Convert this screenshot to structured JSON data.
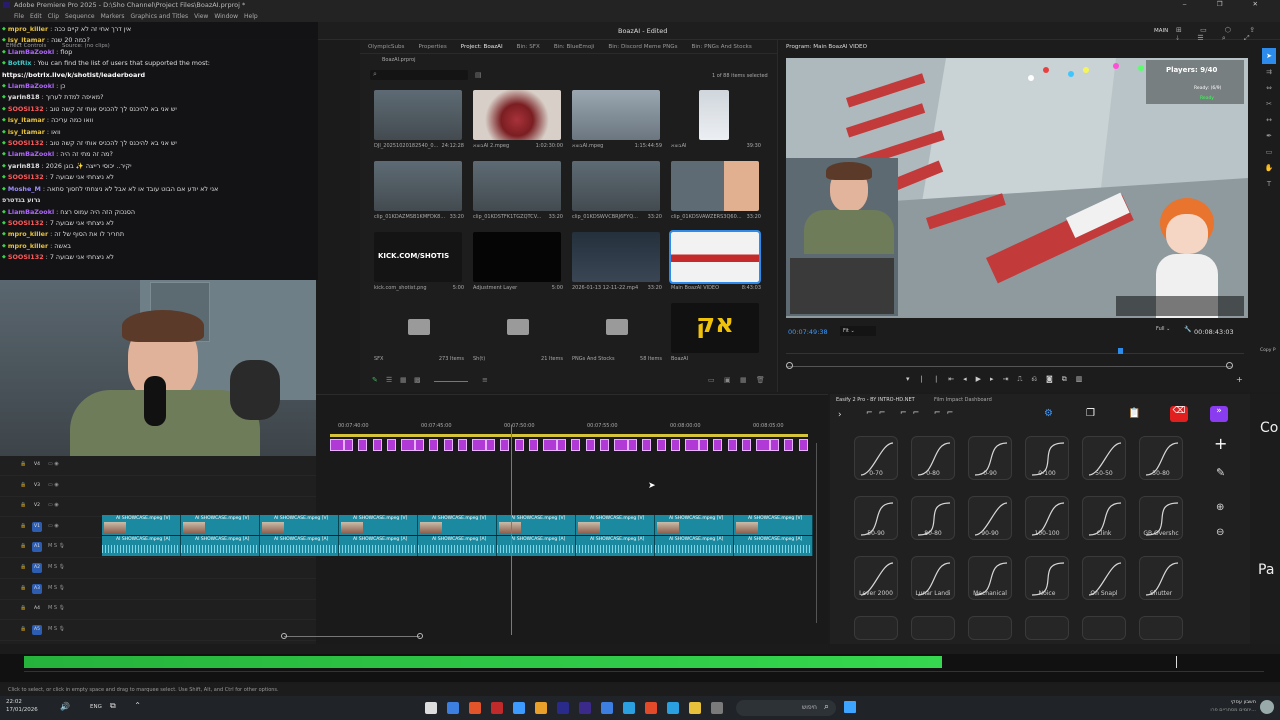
{
  "window": {
    "title": "Adobe Premiere Pro 2025 - D:\\Sho Channel\\Project Files\\BoazAI.prproj *",
    "center_title": "BoazAI - Edited",
    "workspace": "MAIN"
  },
  "menu": [
    "File",
    "Edit",
    "Clip",
    "Sequence",
    "Markers",
    "Graphics and Titles",
    "View",
    "Window",
    "Help"
  ],
  "chat": [
    {
      "user": "mpro_killer",
      "sep": ":",
      "msg": "אין דרך אחי זה לא קיים ככה",
      "color": "#e8c23a"
    },
    {
      "user": "isy_itamar",
      "sep": ":",
      "msg": "כמה 20 שנה?",
      "color": "#e8c23a"
    },
    {
      "user": "LiamBaZookl",
      "sep": ":",
      "msg": "flop",
      "color": "#b066ff"
    },
    {
      "user": "BotRix",
      "sep": ":",
      "msg": "You can find the list of users that supported the most:",
      "color": "#40c9c9"
    },
    {
      "user": "",
      "sep": "",
      "msg": "https://botrix.live/k/shotist/leaderboard",
      "color": "#ffffff"
    },
    {
      "user": "LiamBaZookl",
      "sep": ":",
      "msg": "כן",
      "color": "#b066ff"
    },
    {
      "user": "yarin818",
      "sep": ":",
      "msg": "מאיפה למדת לערוך?",
      "color": "#e0e0e0"
    },
    {
      "user": "SOOSI132",
      "sep": ":",
      "msg": "יש אני בא להיכנס לך להכניס אותי זה קשה טוב",
      "color": "#ff5a5a"
    },
    {
      "user": "isy_itamar",
      "sep": ":",
      "msg": "וואו כמה עריכה",
      "color": "#e8c23a"
    },
    {
      "user": "isy_itamar",
      "sep": ":",
      "msg": "וואו",
      "color": "#e8c23a"
    },
    {
      "user": "SOOSI132",
      "sep": ":",
      "msg": "יש אני בא להיכנס לך להכניס אותי זה קשה טוב",
      "color": "#ff5a5a"
    },
    {
      "user": "LiamBaZookl",
      "sep": ":",
      "msg": "מה זה מתי זה היה?",
      "color": "#b066ff"
    },
    {
      "user": "yarin818",
      "sep": ":",
      "msg": "יקיר.. יכוסי רייצה ✨ בוגן 2026",
      "color": "#e0e0e0"
    },
    {
      "user": "SOOSI132",
      "sep": ":",
      "msg": "לא ניצחתי אני שבועה 7",
      "color": "#ff5a5a"
    },
    {
      "user": "Moshe_M",
      "sep": ":",
      "msg": "אני לא יודע אם הבוט עובד או לא אבל לא ניצחתי לחסוך סתאה",
      "color": "#9b8cff"
    },
    {
      "user": "",
      "sep": "",
      "msg": "גרוע בגדטרפ",
      "color": "#dddddd"
    },
    {
      "user": "LiamBaZookl",
      "sep": ":",
      "msg": "הסנכוק הזה היה עמוס רצח",
      "color": "#b066ff"
    },
    {
      "user": "SOOSI132",
      "sep": ":",
      "msg": "לא ניצחתי אני שבועה 7",
      "color": "#ff5a5a"
    },
    {
      "user": "mpro_killer",
      "sep": ":",
      "msg": "תחריר לו את הסוף של זה",
      "color": "#e8c23a"
    },
    {
      "user": "mpro_killer",
      "sep": ":",
      "msg": "באשה",
      "color": "#e8c23a"
    },
    {
      "user": "SOOSI132",
      "sep": ":",
      "msg": "לא ניצחתי אני שבועה 7",
      "color": "#ff5a5a"
    }
  ],
  "left_panel_tabs": [
    "Effect Controls",
    "Source: (no clips)"
  ],
  "project": {
    "tabs": [
      "OlympicSubs",
      "Properties",
      "Project: BoazAI",
      "Bin: SFX",
      "Bin: BlueEmoji",
      "Bin: Discord Meme PNGs",
      "Bin: PNGs And Stocks"
    ],
    "active_tab": "Project: BoazAI",
    "file": "BoazAI.prproj",
    "count": "1 of 88 items selected",
    "items": [
      {
        "name": "DJI_20251020182540_0...",
        "dur": "24:12:28",
        "kind": "webcam"
      },
      {
        "name": "בוצאAI 2.mpeg",
        "dur": "1:02:30:00",
        "kind": "food"
      },
      {
        "name": "בוצאAI.mpeg",
        "dur": "1:15:44:59",
        "kind": "room"
      },
      {
        "name": "בוצאAI",
        "dur": "39:30",
        "kind": "avatar"
      },
      {
        "name": "clip_01KDAZMSB1KMFDK8...",
        "dur": "33:20",
        "kind": "webcam"
      },
      {
        "name": "clip_01KDSTFK1TGZQTCV...",
        "dur": "33:20",
        "kind": "webcam"
      },
      {
        "name": "clip_01KDSWVCBRJ6FYQ...",
        "dur": "33:20",
        "kind": "webcam"
      },
      {
        "name": "clip_01KDSVAWZERS3Q60...",
        "dur": "33:20",
        "kind": "avatarcam"
      },
      {
        "name": "kick.com_shotist.png",
        "dur": "5:00",
        "kind": "kick"
      },
      {
        "name": "Adjustment Layer",
        "dur": "5:00",
        "kind": "black"
      },
      {
        "name": "2026-01-13 12-11-22.mp4",
        "dur": "33:20",
        "kind": "screen"
      },
      {
        "name": "Main BoazAI VIDEO",
        "dur": "8:43:03",
        "kind": "sequence"
      },
      {
        "name": "SFX",
        "dur": "273 Items",
        "kind": "folder"
      },
      {
        "name": "Sh(t)",
        "dur": "",
        "kind": "folder"
      },
      {
        "name": "PNGs And Stocks",
        "dur": "58 Items",
        "kind": "folder"
      },
      {
        "name": "BoazAI",
        "dur": "",
        "kind": "logo"
      }
    ],
    "folder_mid_count": "21 Items",
    "kick_text": "KICK.COM/SHOTIS",
    "logo_text": "אק"
  },
  "program": {
    "tab": "Program: Main BoazAI VIDEO",
    "timecode": "00:07:49:38",
    "fit": "Fit",
    "quality": "Full",
    "duration": "00:08:43:03",
    "players": "Players: 9/40",
    "ready": "Ready: (6/9)",
    "ready_word": "Ready",
    "copy_label": "Copy P"
  },
  "timeline": {
    "ruler": [
      "00:07:40:00",
      "00:07:45:00",
      "00:07:50:00",
      "00:07:55:00",
      "00:08:00:00",
      "00:08:05:00"
    ],
    "clip_label_v": "AI SHOWCASE.mpeg [V]",
    "clip_label_a": "AI SHOWCASE.mpeg [A]",
    "playhead": 0.38
  },
  "track_headers": [
    "V4",
    "V3",
    "V2",
    "V1",
    "A1",
    "A2",
    "A3",
    "A4",
    "A5"
  ],
  "ease": {
    "tabs": [
      "Easify 2 Pro - BY INTRO-HD.NET",
      "Film Impact Dashboard"
    ],
    "presets": [
      "0-70",
      "0-80",
      "0-90",
      "0-100",
      "50-50",
      "50-80",
      "50-90",
      "80-80",
      "90-90",
      "100-100",
      "Clink",
      "GB Overshc",
      "Lever 2000",
      "Lunar Landi",
      "Mechanical",
      "Noice",
      "On Snapl",
      "Shutter"
    ],
    "side_labels": [
      "Co",
      "Pa"
    ]
  },
  "audio": {
    "level": 0.74
  },
  "status": "Click to select, or click in empty space and drag to marquee select. Use Shift, Alt, and Ctrl for other options.",
  "taskbar": {
    "time": "22:02",
    "date": "17/01/2026",
    "lang": "ENG",
    "search": "חיפוש",
    "notif_title": "חשבון עסקי",
    "notif_sub": "יוזמים מסחריים פרו..."
  },
  "colors": {
    "accent": "#2d8ceb",
    "clip_teal": "#1b8aa0",
    "clip_purple": "#b13ad6",
    "audio_green": "#2ecc40"
  }
}
